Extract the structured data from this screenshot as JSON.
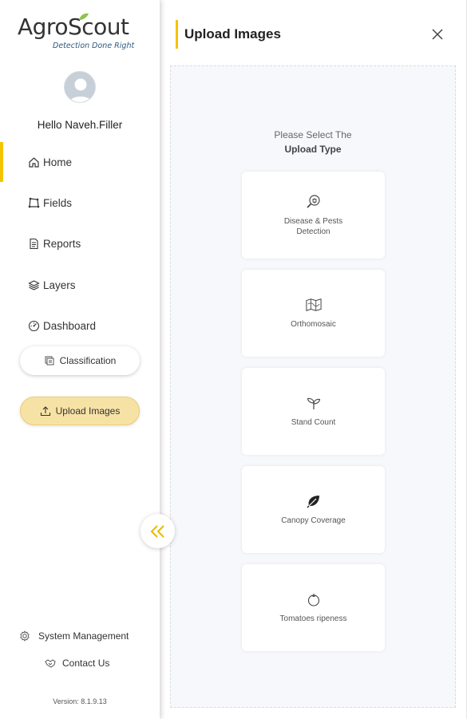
{
  "brand": {
    "name": "AgroScout",
    "tagline": "Detection Done Right"
  },
  "user": {
    "greeting": "Hello Naveh.Filler"
  },
  "sidebar": {
    "nav": [
      {
        "label": "Home",
        "icon": "home-icon",
        "active": true
      },
      {
        "label": "Fields",
        "icon": "fields-icon"
      },
      {
        "label": "Reports",
        "icon": "reports-icon"
      },
      {
        "label": "Layers",
        "icon": "layers-icon"
      },
      {
        "label": "Dashboard",
        "icon": "dashboard-icon"
      }
    ],
    "classification_label": "Classification",
    "upload_label": "Upload Images",
    "system_management_label": "System Management",
    "contact_label": "Contact Us",
    "version": "Version: 8.1.9.13"
  },
  "panel": {
    "title": "Upload Images",
    "prompt_line1": "Please Select The",
    "prompt_line2": "Upload Type",
    "cards": [
      {
        "label": "Disease & Pests Detection",
        "icon": "magnifier-bug-icon"
      },
      {
        "label": "Orthomosaic",
        "icon": "map-icon"
      },
      {
        "label": "Stand Count",
        "icon": "sprout-icon"
      },
      {
        "label": "Canopy Coverage",
        "icon": "leaf-icon"
      },
      {
        "label": "Tomatoes ripeness",
        "icon": "tomato-icon"
      }
    ]
  },
  "colors": {
    "accent": "#f5c400",
    "upload_pill_bg": "#f7e2a6",
    "collapse_chevron": "#e8b900",
    "logo_leaf": "#8bc34a",
    "tagline": "#2a5a80"
  }
}
